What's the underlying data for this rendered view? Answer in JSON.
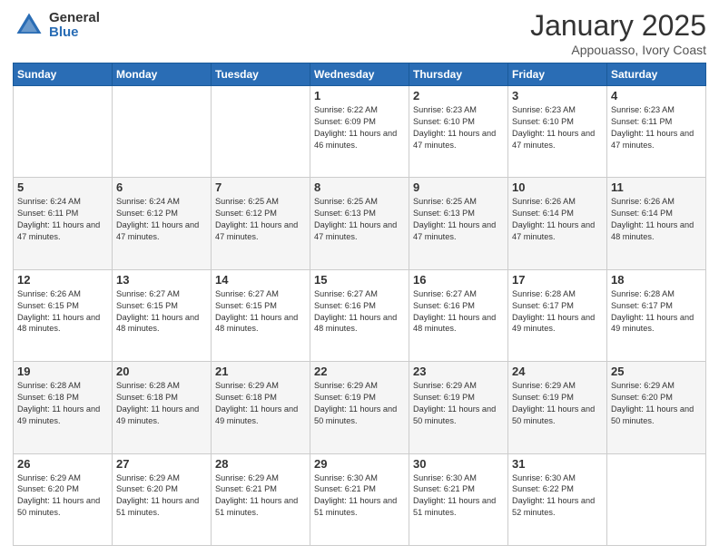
{
  "header": {
    "logo_general": "General",
    "logo_blue": "Blue",
    "title": "January 2025",
    "location": "Appouasso, Ivory Coast"
  },
  "weekdays": [
    "Sunday",
    "Monday",
    "Tuesday",
    "Wednesday",
    "Thursday",
    "Friday",
    "Saturday"
  ],
  "weeks": [
    [
      {
        "day": "",
        "sunrise": "",
        "sunset": "",
        "daylight": ""
      },
      {
        "day": "",
        "sunrise": "",
        "sunset": "",
        "daylight": ""
      },
      {
        "day": "",
        "sunrise": "",
        "sunset": "",
        "daylight": ""
      },
      {
        "day": "1",
        "sunrise": "Sunrise: 6:22 AM",
        "sunset": "Sunset: 6:09 PM",
        "daylight": "Daylight: 11 hours and 46 minutes."
      },
      {
        "day": "2",
        "sunrise": "Sunrise: 6:23 AM",
        "sunset": "Sunset: 6:10 PM",
        "daylight": "Daylight: 11 hours and 47 minutes."
      },
      {
        "day": "3",
        "sunrise": "Sunrise: 6:23 AM",
        "sunset": "Sunset: 6:10 PM",
        "daylight": "Daylight: 11 hours and 47 minutes."
      },
      {
        "day": "4",
        "sunrise": "Sunrise: 6:23 AM",
        "sunset": "Sunset: 6:11 PM",
        "daylight": "Daylight: 11 hours and 47 minutes."
      }
    ],
    [
      {
        "day": "5",
        "sunrise": "Sunrise: 6:24 AM",
        "sunset": "Sunset: 6:11 PM",
        "daylight": "Daylight: 11 hours and 47 minutes."
      },
      {
        "day": "6",
        "sunrise": "Sunrise: 6:24 AM",
        "sunset": "Sunset: 6:12 PM",
        "daylight": "Daylight: 11 hours and 47 minutes."
      },
      {
        "day": "7",
        "sunrise": "Sunrise: 6:25 AM",
        "sunset": "Sunset: 6:12 PM",
        "daylight": "Daylight: 11 hours and 47 minutes."
      },
      {
        "day": "8",
        "sunrise": "Sunrise: 6:25 AM",
        "sunset": "Sunset: 6:13 PM",
        "daylight": "Daylight: 11 hours and 47 minutes."
      },
      {
        "day": "9",
        "sunrise": "Sunrise: 6:25 AM",
        "sunset": "Sunset: 6:13 PM",
        "daylight": "Daylight: 11 hours and 47 minutes."
      },
      {
        "day": "10",
        "sunrise": "Sunrise: 6:26 AM",
        "sunset": "Sunset: 6:14 PM",
        "daylight": "Daylight: 11 hours and 47 minutes."
      },
      {
        "day": "11",
        "sunrise": "Sunrise: 6:26 AM",
        "sunset": "Sunset: 6:14 PM",
        "daylight": "Daylight: 11 hours and 48 minutes."
      }
    ],
    [
      {
        "day": "12",
        "sunrise": "Sunrise: 6:26 AM",
        "sunset": "Sunset: 6:15 PM",
        "daylight": "Daylight: 11 hours and 48 minutes."
      },
      {
        "day": "13",
        "sunrise": "Sunrise: 6:27 AM",
        "sunset": "Sunset: 6:15 PM",
        "daylight": "Daylight: 11 hours and 48 minutes."
      },
      {
        "day": "14",
        "sunrise": "Sunrise: 6:27 AM",
        "sunset": "Sunset: 6:15 PM",
        "daylight": "Daylight: 11 hours and 48 minutes."
      },
      {
        "day": "15",
        "sunrise": "Sunrise: 6:27 AM",
        "sunset": "Sunset: 6:16 PM",
        "daylight": "Daylight: 11 hours and 48 minutes."
      },
      {
        "day": "16",
        "sunrise": "Sunrise: 6:27 AM",
        "sunset": "Sunset: 6:16 PM",
        "daylight": "Daylight: 11 hours and 48 minutes."
      },
      {
        "day": "17",
        "sunrise": "Sunrise: 6:28 AM",
        "sunset": "Sunset: 6:17 PM",
        "daylight": "Daylight: 11 hours and 49 minutes."
      },
      {
        "day": "18",
        "sunrise": "Sunrise: 6:28 AM",
        "sunset": "Sunset: 6:17 PM",
        "daylight": "Daylight: 11 hours and 49 minutes."
      }
    ],
    [
      {
        "day": "19",
        "sunrise": "Sunrise: 6:28 AM",
        "sunset": "Sunset: 6:18 PM",
        "daylight": "Daylight: 11 hours and 49 minutes."
      },
      {
        "day": "20",
        "sunrise": "Sunrise: 6:28 AM",
        "sunset": "Sunset: 6:18 PM",
        "daylight": "Daylight: 11 hours and 49 minutes."
      },
      {
        "day": "21",
        "sunrise": "Sunrise: 6:29 AM",
        "sunset": "Sunset: 6:18 PM",
        "daylight": "Daylight: 11 hours and 49 minutes."
      },
      {
        "day": "22",
        "sunrise": "Sunrise: 6:29 AM",
        "sunset": "Sunset: 6:19 PM",
        "daylight": "Daylight: 11 hours and 50 minutes."
      },
      {
        "day": "23",
        "sunrise": "Sunrise: 6:29 AM",
        "sunset": "Sunset: 6:19 PM",
        "daylight": "Daylight: 11 hours and 50 minutes."
      },
      {
        "day": "24",
        "sunrise": "Sunrise: 6:29 AM",
        "sunset": "Sunset: 6:19 PM",
        "daylight": "Daylight: 11 hours and 50 minutes."
      },
      {
        "day": "25",
        "sunrise": "Sunrise: 6:29 AM",
        "sunset": "Sunset: 6:20 PM",
        "daylight": "Daylight: 11 hours and 50 minutes."
      }
    ],
    [
      {
        "day": "26",
        "sunrise": "Sunrise: 6:29 AM",
        "sunset": "Sunset: 6:20 PM",
        "daylight": "Daylight: 11 hours and 50 minutes."
      },
      {
        "day": "27",
        "sunrise": "Sunrise: 6:29 AM",
        "sunset": "Sunset: 6:20 PM",
        "daylight": "Daylight: 11 hours and 51 minutes."
      },
      {
        "day": "28",
        "sunrise": "Sunrise: 6:29 AM",
        "sunset": "Sunset: 6:21 PM",
        "daylight": "Daylight: 11 hours and 51 minutes."
      },
      {
        "day": "29",
        "sunrise": "Sunrise: 6:30 AM",
        "sunset": "Sunset: 6:21 PM",
        "daylight": "Daylight: 11 hours and 51 minutes."
      },
      {
        "day": "30",
        "sunrise": "Sunrise: 6:30 AM",
        "sunset": "Sunset: 6:21 PM",
        "daylight": "Daylight: 11 hours and 51 minutes."
      },
      {
        "day": "31",
        "sunrise": "Sunrise: 6:30 AM",
        "sunset": "Sunset: 6:22 PM",
        "daylight": "Daylight: 11 hours and 52 minutes."
      },
      {
        "day": "",
        "sunrise": "",
        "sunset": "",
        "daylight": ""
      }
    ]
  ]
}
